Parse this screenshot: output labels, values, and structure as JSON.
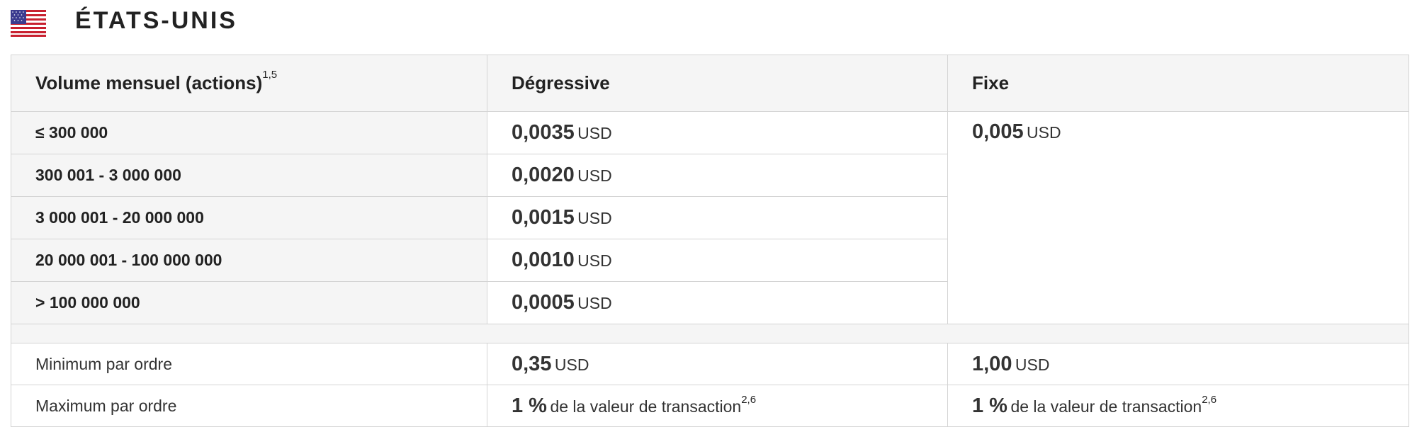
{
  "country": {
    "flag_icon": "us-flag-icon",
    "title": "ÉTATS-UNIS"
  },
  "table": {
    "headers": {
      "volume": "Volume mensuel (actions)",
      "volume_sup": "1,5",
      "degressive": "Dégressive",
      "fixed": "Fixe"
    },
    "tiers": [
      {
        "label": "≤ 300 000",
        "price": "0,0035",
        "unit": "USD"
      },
      {
        "label": "300 001 - 3 000 000",
        "price": "0,0020",
        "unit": "USD"
      },
      {
        "label": "3 000 001 - 20 000 000",
        "price": "0,0015",
        "unit": "USD"
      },
      {
        "label": "20 000 001 - 100 000 000",
        "price": "0,0010",
        "unit": "USD"
      },
      {
        "label": "> 100 000 000",
        "price": "0,0005",
        "unit": "USD"
      }
    ],
    "fixed_price": {
      "value": "0,005",
      "unit": "USD"
    },
    "minimum": {
      "label": "Minimum par ordre",
      "degressive_value": "0,35",
      "degressive_unit": "USD",
      "fixed_value": "1,00",
      "fixed_unit": "USD"
    },
    "maximum": {
      "label": "Maximum par ordre",
      "degressive_pct": "1 %",
      "degressive_text": "de la valeur de transaction",
      "degressive_sup": "2,6",
      "fixed_pct": "1 %",
      "fixed_text": "de la valeur de transaction",
      "fixed_sup": "2,6"
    }
  }
}
